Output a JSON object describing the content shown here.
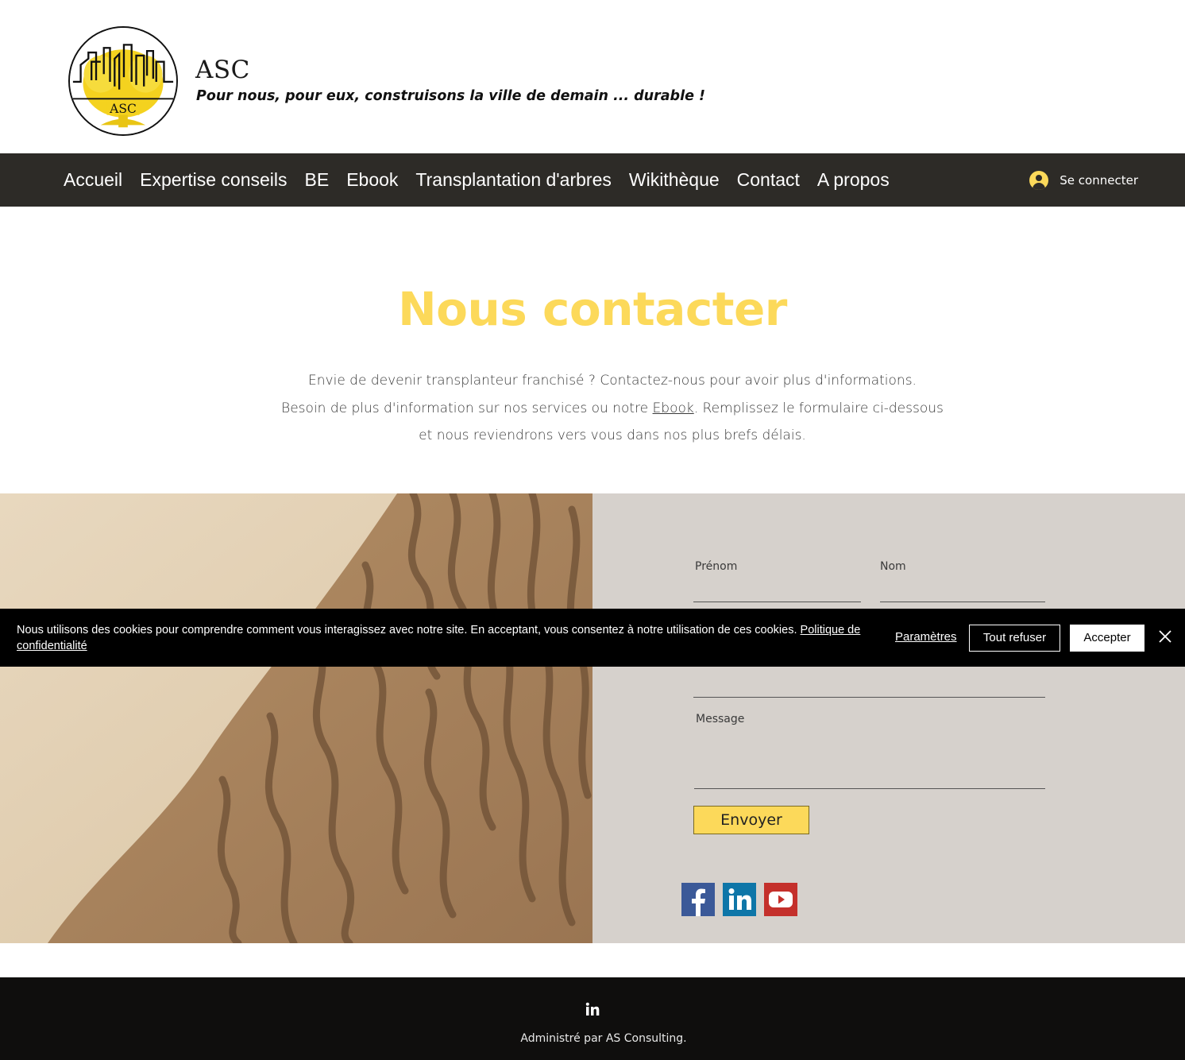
{
  "header": {
    "brand_title": "ASC",
    "tagline": "Pour nous, pour eux, construisons la ville de demain ... durable !",
    "logo_text": "ASC"
  },
  "nav": {
    "items": [
      {
        "label": "Accueil"
      },
      {
        "label": "Expertise conseils"
      },
      {
        "label": "BE"
      },
      {
        "label": "Ebook"
      },
      {
        "label": "Transplantation d'arbres"
      },
      {
        "label": "Wikithèque"
      },
      {
        "label": "Contact"
      },
      {
        "label": "A propos"
      }
    ],
    "login_label": "Se connecter",
    "login_icon": "user-avatar-icon"
  },
  "hero": {
    "title": "Nous contacter",
    "line1": "Envie de devenir transplanteur franchisé ? Contactez-nous pour avoir plus d'informations.",
    "line2_before": "Besoin de plus d'information sur nos services ou notre ",
    "line2_link": "Ebook",
    "line2_after": ". Remplissez le formulaire ci-dessous et nous reviendrons vers vous dans nos plus brefs délais."
  },
  "form": {
    "first_name_label": "Prénom",
    "last_name_label": "Nom",
    "message_label": "Message",
    "submit_label": "Envoyer",
    "social": [
      {
        "name": "facebook-icon"
      },
      {
        "name": "linkedin-icon"
      },
      {
        "name": "youtube-icon"
      }
    ]
  },
  "cookie_banner": {
    "text": "Nous utilisons des cookies pour comprendre comment vous interagissez avec notre site. En acceptant, vous consentez à notre utilisation de ces cookies. ",
    "policy_link": "Politique de confidentialité",
    "settings_label": "Paramètres",
    "refuse_label": "Tout refuser",
    "accept_label": "Accepter"
  },
  "footer": {
    "text": "Administré par AS Consulting."
  },
  "colors": {
    "accent_yellow": "#fcd95a",
    "nav_bg": "#2d2b27",
    "form_bg": "#d6d1cc",
    "footer_bg": "#0f0e0d",
    "cookie_bg": "#000000"
  }
}
